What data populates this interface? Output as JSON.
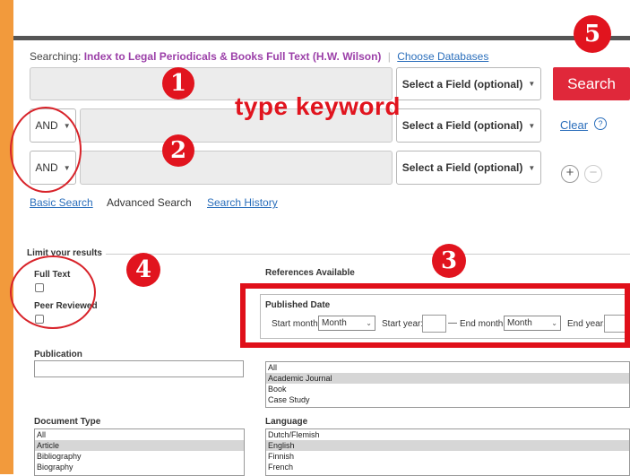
{
  "header": {
    "searching_label": "Searching:",
    "database_name": "Index to Legal Periodicals & Books Full Text (H.W. Wilson)",
    "separator": "|",
    "choose_databases": "Choose Databases"
  },
  "search_rows": [
    {
      "operator": "",
      "field": "Select a Field (optional)"
    },
    {
      "operator": "AND",
      "field": "Select a Field (optional)"
    },
    {
      "operator": "AND",
      "field": "Select a Field (optional)"
    }
  ],
  "actions": {
    "search_label": "Search",
    "clear_label": "Clear",
    "help_symbol": "?",
    "add_symbol": "+",
    "remove_symbol": "−"
  },
  "modes": {
    "basic": "Basic Search",
    "advanced": "Advanced Search",
    "history": "Search History"
  },
  "limits": {
    "legend": "Limit your results",
    "full_text": "Full Text",
    "peer_reviewed": "Peer Reviewed",
    "references_available": "References Available",
    "publication": "Publication",
    "published_date": {
      "title": "Published Date",
      "start_month_label": "Start month:",
      "start_month_value": "Month",
      "start_year_label": "Start year:",
      "dash": "—",
      "end_month_label": "End month:",
      "end_month_value": "Month",
      "end_year_label": "End year:"
    },
    "publication_type": {
      "options": [
        "All",
        "Academic Journal",
        "Book",
        "Case Study"
      ],
      "selected": "Academic Journal"
    },
    "document_type": {
      "label": "Document Type",
      "options": [
        "All",
        "Article",
        "Bibliography",
        "Biography"
      ],
      "selected": "Article"
    },
    "language": {
      "label": "Language",
      "options": [
        "Dutch/Flemish",
        "English",
        "Finnish",
        "French"
      ],
      "selected": "English"
    }
  },
  "annotations": {
    "badge1": "1",
    "badge2": "2",
    "badge3": "3",
    "badge4": "4",
    "badge5": "5",
    "keyword_note": "type keyword"
  },
  "colors": {
    "accent": "#e0283a",
    "annotation_red": "#e1141e",
    "link": "#2a6ebb",
    "database_purple": "#9b3fa8",
    "side_strip": "#f29a3c"
  }
}
